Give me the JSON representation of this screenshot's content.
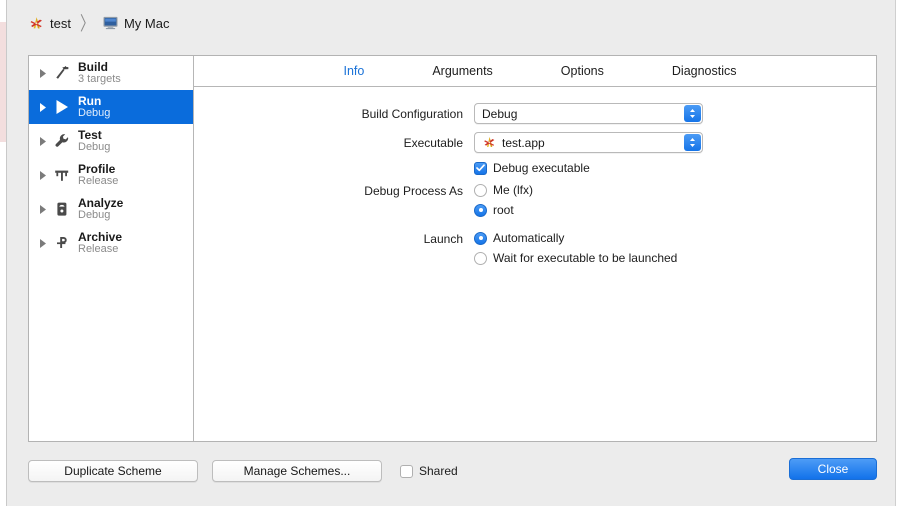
{
  "titlebar": {
    "project_name": "test",
    "separator": "〉",
    "destination": "My Mac",
    "project_icon": "xcode-app-icon",
    "destination_icon": "mac-display-icon"
  },
  "sidebar": {
    "items": [
      {
        "title": "Build",
        "subtitle": "3 targets",
        "icon": "hammer-icon",
        "selected": false
      },
      {
        "title": "Run",
        "subtitle": "Debug",
        "icon": "play-icon",
        "selected": true
      },
      {
        "title": "Test",
        "subtitle": "Debug",
        "icon": "wrench-icon",
        "selected": false
      },
      {
        "title": "Profile",
        "subtitle": "Release",
        "icon": "speedometer-icon",
        "selected": false
      },
      {
        "title": "Analyze",
        "subtitle": "Debug",
        "icon": "analyze-icon",
        "selected": false
      },
      {
        "title": "Archive",
        "subtitle": "Release",
        "icon": "archive-icon",
        "selected": false
      }
    ]
  },
  "tabs": [
    {
      "label": "Info",
      "active": true
    },
    {
      "label": "Arguments",
      "active": false
    },
    {
      "label": "Options",
      "active": false
    },
    {
      "label": "Diagnostics",
      "active": false
    }
  ],
  "form": {
    "build_configuration": {
      "label": "Build Configuration",
      "value": "Debug"
    },
    "executable": {
      "label": "Executable",
      "value": "test.app",
      "icon": "xcode-app-icon"
    },
    "debug_executable": {
      "label": "Debug executable",
      "checked": true
    },
    "debug_process_as": {
      "label": "Debug Process As",
      "options": [
        {
          "label": "Me (lfx)",
          "selected": false
        },
        {
          "label": "root",
          "selected": true
        }
      ]
    },
    "launch": {
      "label": "Launch",
      "options": [
        {
          "label": "Automatically",
          "selected": true
        },
        {
          "label": "Wait for executable to be launched",
          "selected": false
        }
      ]
    }
  },
  "bottom": {
    "duplicate_scheme": "Duplicate Scheme",
    "manage_schemes": "Manage Schemes...",
    "shared_label": "Shared",
    "shared_checked": false,
    "close": "Close"
  },
  "colors": {
    "accent_blue": "#0a6cdc",
    "tab_active": "#1a72d8",
    "control_blue": "#1574e8",
    "sheet_bg": "#ececec",
    "panel_bg": "#ffffff",
    "border": "#b6b6b6",
    "subtitle_gray": "#8b8b8b"
  }
}
